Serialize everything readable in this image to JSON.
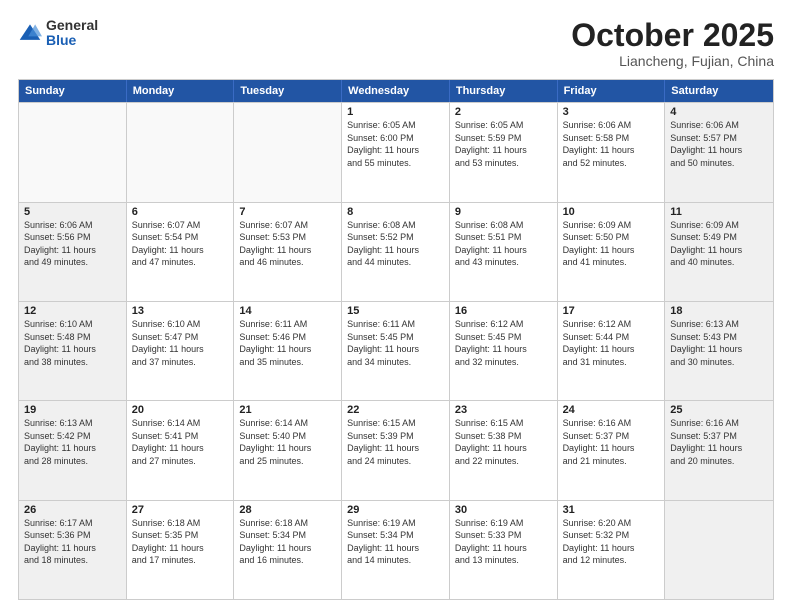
{
  "header": {
    "logo": {
      "general": "General",
      "blue": "Blue"
    },
    "title": "October 2025",
    "subtitle": "Liancheng, Fujian, China"
  },
  "weekdays": [
    "Sunday",
    "Monday",
    "Tuesday",
    "Wednesday",
    "Thursday",
    "Friday",
    "Saturday"
  ],
  "rows": [
    [
      {
        "day": "",
        "text": "",
        "empty": true
      },
      {
        "day": "",
        "text": "",
        "empty": true
      },
      {
        "day": "",
        "text": "",
        "empty": true
      },
      {
        "day": "1",
        "text": "Sunrise: 6:05 AM\nSunset: 6:00 PM\nDaylight: 11 hours\nand 55 minutes.",
        "empty": false
      },
      {
        "day": "2",
        "text": "Sunrise: 6:05 AM\nSunset: 5:59 PM\nDaylight: 11 hours\nand 53 minutes.",
        "empty": false
      },
      {
        "day": "3",
        "text": "Sunrise: 6:06 AM\nSunset: 5:58 PM\nDaylight: 11 hours\nand 52 minutes.",
        "empty": false
      },
      {
        "day": "4",
        "text": "Sunrise: 6:06 AM\nSunset: 5:57 PM\nDaylight: 11 hours\nand 50 minutes.",
        "empty": false,
        "shaded": true
      }
    ],
    [
      {
        "day": "5",
        "text": "Sunrise: 6:06 AM\nSunset: 5:56 PM\nDaylight: 11 hours\nand 49 minutes.",
        "empty": false,
        "shaded": true
      },
      {
        "day": "6",
        "text": "Sunrise: 6:07 AM\nSunset: 5:54 PM\nDaylight: 11 hours\nand 47 minutes.",
        "empty": false
      },
      {
        "day": "7",
        "text": "Sunrise: 6:07 AM\nSunset: 5:53 PM\nDaylight: 11 hours\nand 46 minutes.",
        "empty": false
      },
      {
        "day": "8",
        "text": "Sunrise: 6:08 AM\nSunset: 5:52 PM\nDaylight: 11 hours\nand 44 minutes.",
        "empty": false
      },
      {
        "day": "9",
        "text": "Sunrise: 6:08 AM\nSunset: 5:51 PM\nDaylight: 11 hours\nand 43 minutes.",
        "empty": false
      },
      {
        "day": "10",
        "text": "Sunrise: 6:09 AM\nSunset: 5:50 PM\nDaylight: 11 hours\nand 41 minutes.",
        "empty": false
      },
      {
        "day": "11",
        "text": "Sunrise: 6:09 AM\nSunset: 5:49 PM\nDaylight: 11 hours\nand 40 minutes.",
        "empty": false,
        "shaded": true
      }
    ],
    [
      {
        "day": "12",
        "text": "Sunrise: 6:10 AM\nSunset: 5:48 PM\nDaylight: 11 hours\nand 38 minutes.",
        "empty": false,
        "shaded": true
      },
      {
        "day": "13",
        "text": "Sunrise: 6:10 AM\nSunset: 5:47 PM\nDaylight: 11 hours\nand 37 minutes.",
        "empty": false
      },
      {
        "day": "14",
        "text": "Sunrise: 6:11 AM\nSunset: 5:46 PM\nDaylight: 11 hours\nand 35 minutes.",
        "empty": false
      },
      {
        "day": "15",
        "text": "Sunrise: 6:11 AM\nSunset: 5:45 PM\nDaylight: 11 hours\nand 34 minutes.",
        "empty": false
      },
      {
        "day": "16",
        "text": "Sunrise: 6:12 AM\nSunset: 5:45 PM\nDaylight: 11 hours\nand 32 minutes.",
        "empty": false
      },
      {
        "day": "17",
        "text": "Sunrise: 6:12 AM\nSunset: 5:44 PM\nDaylight: 11 hours\nand 31 minutes.",
        "empty": false
      },
      {
        "day": "18",
        "text": "Sunrise: 6:13 AM\nSunset: 5:43 PM\nDaylight: 11 hours\nand 30 minutes.",
        "empty": false,
        "shaded": true
      }
    ],
    [
      {
        "day": "19",
        "text": "Sunrise: 6:13 AM\nSunset: 5:42 PM\nDaylight: 11 hours\nand 28 minutes.",
        "empty": false,
        "shaded": true
      },
      {
        "day": "20",
        "text": "Sunrise: 6:14 AM\nSunset: 5:41 PM\nDaylight: 11 hours\nand 27 minutes.",
        "empty": false
      },
      {
        "day": "21",
        "text": "Sunrise: 6:14 AM\nSunset: 5:40 PM\nDaylight: 11 hours\nand 25 minutes.",
        "empty": false
      },
      {
        "day": "22",
        "text": "Sunrise: 6:15 AM\nSunset: 5:39 PM\nDaylight: 11 hours\nand 24 minutes.",
        "empty": false
      },
      {
        "day": "23",
        "text": "Sunrise: 6:15 AM\nSunset: 5:38 PM\nDaylight: 11 hours\nand 22 minutes.",
        "empty": false
      },
      {
        "day": "24",
        "text": "Sunrise: 6:16 AM\nSunset: 5:37 PM\nDaylight: 11 hours\nand 21 minutes.",
        "empty": false
      },
      {
        "day": "25",
        "text": "Sunrise: 6:16 AM\nSunset: 5:37 PM\nDaylight: 11 hours\nand 20 minutes.",
        "empty": false,
        "shaded": true
      }
    ],
    [
      {
        "day": "26",
        "text": "Sunrise: 6:17 AM\nSunset: 5:36 PM\nDaylight: 11 hours\nand 18 minutes.",
        "empty": false,
        "shaded": true
      },
      {
        "day": "27",
        "text": "Sunrise: 6:18 AM\nSunset: 5:35 PM\nDaylight: 11 hours\nand 17 minutes.",
        "empty": false
      },
      {
        "day": "28",
        "text": "Sunrise: 6:18 AM\nSunset: 5:34 PM\nDaylight: 11 hours\nand 16 minutes.",
        "empty": false
      },
      {
        "day": "29",
        "text": "Sunrise: 6:19 AM\nSunset: 5:34 PM\nDaylight: 11 hours\nand 14 minutes.",
        "empty": false
      },
      {
        "day": "30",
        "text": "Sunrise: 6:19 AM\nSunset: 5:33 PM\nDaylight: 11 hours\nand 13 minutes.",
        "empty": false
      },
      {
        "day": "31",
        "text": "Sunrise: 6:20 AM\nSunset: 5:32 PM\nDaylight: 11 hours\nand 12 minutes.",
        "empty": false
      },
      {
        "day": "",
        "text": "",
        "empty": true,
        "shaded": true
      }
    ]
  ]
}
